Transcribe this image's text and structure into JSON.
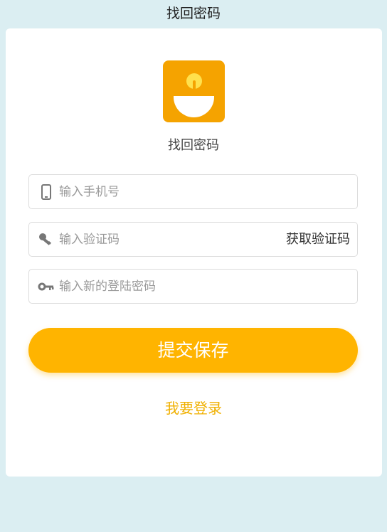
{
  "header": {
    "title": "找回密码"
  },
  "logo": {
    "label": "找回密码",
    "icon": "bulb-smile-logo",
    "bg_color": "#f5a300"
  },
  "form": {
    "phone": {
      "placeholder": "输入手机号",
      "value": "",
      "icon": "phone-icon"
    },
    "code": {
      "placeholder": "输入验证码",
      "value": "",
      "icon": "key-icon",
      "get_code_label": "获取验证码"
    },
    "password": {
      "placeholder": "输入新的登陆密码",
      "value": "",
      "icon": "password-key-icon"
    },
    "submit_label": "提交保存",
    "login_link_label": "我要登录"
  },
  "colors": {
    "background": "#dbeef2",
    "accent": "#ffb400",
    "link": "#f0b000"
  }
}
